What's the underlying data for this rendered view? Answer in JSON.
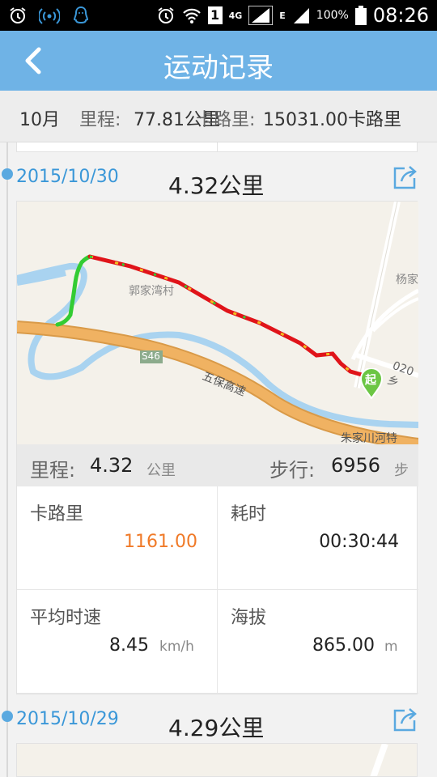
{
  "status_bar": {
    "network": "4G",
    "data_mode": "E",
    "sim_number": "1",
    "battery": "100%",
    "time": "08:26"
  },
  "header": {
    "title": "运动记录"
  },
  "summary": {
    "month": "10月",
    "mileage_label": "里程:",
    "mileage_value": "77.81公里",
    "calorie_label": "卡路里:",
    "calorie_value": "15031.00卡路里"
  },
  "records": [
    {
      "date": "2015/10/30",
      "distance": "4.32公里",
      "map_labels": {
        "village": "郭家湾村",
        "village_right": "杨家",
        "road_s46": "S46",
        "highway": "五保高速",
        "road_020": "020乡",
        "start_marker": "起",
        "bottom_road": "朱家川河特"
      },
      "mileage_label": "里程:",
      "mileage_value": "4.32",
      "mileage_unit": "公里",
      "steps_label": "步行:",
      "steps_value": "6956",
      "steps_unit": "步",
      "calorie_label": "卡路里",
      "calorie_value": "1161.00",
      "duration_label": "耗时",
      "duration_value": "00:30:44",
      "speed_label": "平均时速",
      "speed_value": "8.45",
      "speed_unit": "km/h",
      "altitude_label": "海拔",
      "altitude_value": "865.00",
      "altitude_unit": "m"
    },
    {
      "date": "2015/10/29",
      "distance": "4.29公里"
    }
  ],
  "colors": {
    "header_bg": "#6fb3e6",
    "date_blue": "#3a97d8",
    "calorie_orange": "#f07a28",
    "route_red": "#e0141a",
    "route_green": "#33cc33",
    "highway_orange": "#f0b262",
    "river_blue": "#a9d3f0",
    "start_marker_green": "#6cc644"
  },
  "icons": {
    "back": "back-arrow-icon",
    "share": "share-icon",
    "start_marker": "map-pin-icon"
  }
}
